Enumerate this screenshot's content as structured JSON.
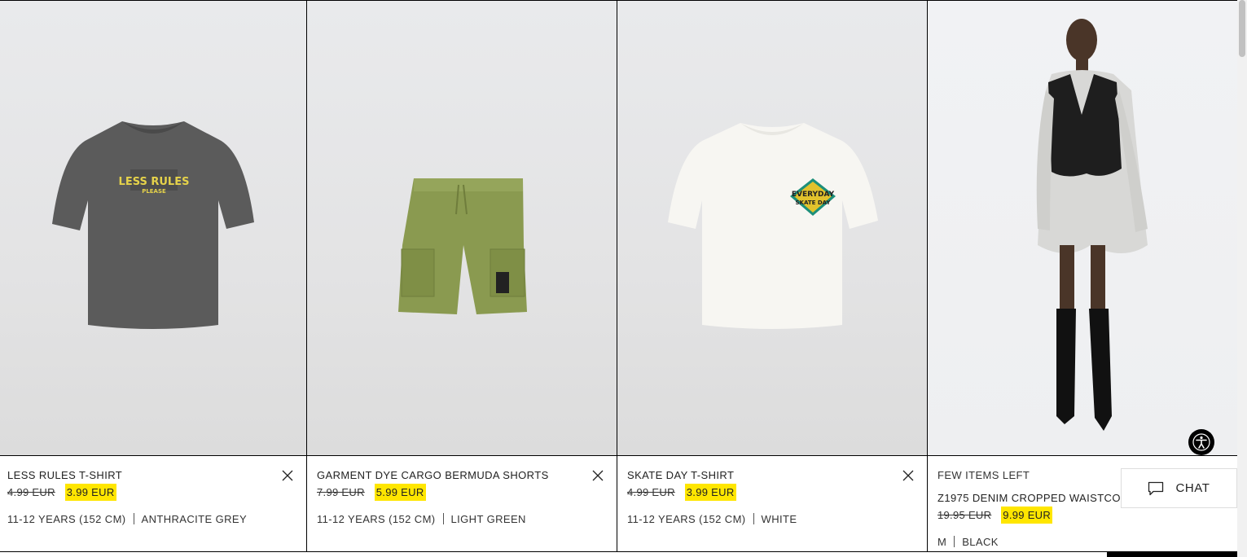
{
  "products": [
    {
      "name": "LESS RULES T-SHIRT",
      "old_price": "4.99 EUR",
      "new_price": "3.99 EUR",
      "size": "11-12 YEARS (152 CM)",
      "color": "ANTHRACITE GREY",
      "print_text_1": "LESS RULES",
      "print_text_2": "PLEASE"
    },
    {
      "name": "GARMENT DYE CARGO BERMUDA SHORTS",
      "old_price": "7.99 EUR",
      "new_price": "5.99 EUR",
      "size": "11-12 YEARS (152 CM)",
      "color": "LIGHT GREEN"
    },
    {
      "name": "SKATE DAY T-SHIRT",
      "old_price": "4.99 EUR",
      "new_price": "3.99 EUR",
      "size": "11-12 YEARS (152 CM)",
      "color": "WHITE",
      "print_text_1": "EVERYDAY",
      "print_text_2": "SKATE DAY"
    },
    {
      "badge": "FEW ITEMS LEFT",
      "name": "Z1975 DENIM CROPPED WAISTCOAT",
      "old_price": "19.95 EUR",
      "new_price": "9.99 EUR",
      "size": "M",
      "color": "BLACK"
    }
  ],
  "chat": {
    "label": "CHAT",
    "icon": "chat-bubble-icon"
  },
  "accessibility": {
    "icon": "accessibility-icon"
  },
  "icons": {
    "remove": "close-icon"
  },
  "colors": {
    "sale_highlight": "#ffe600",
    "border": "#000000"
  }
}
